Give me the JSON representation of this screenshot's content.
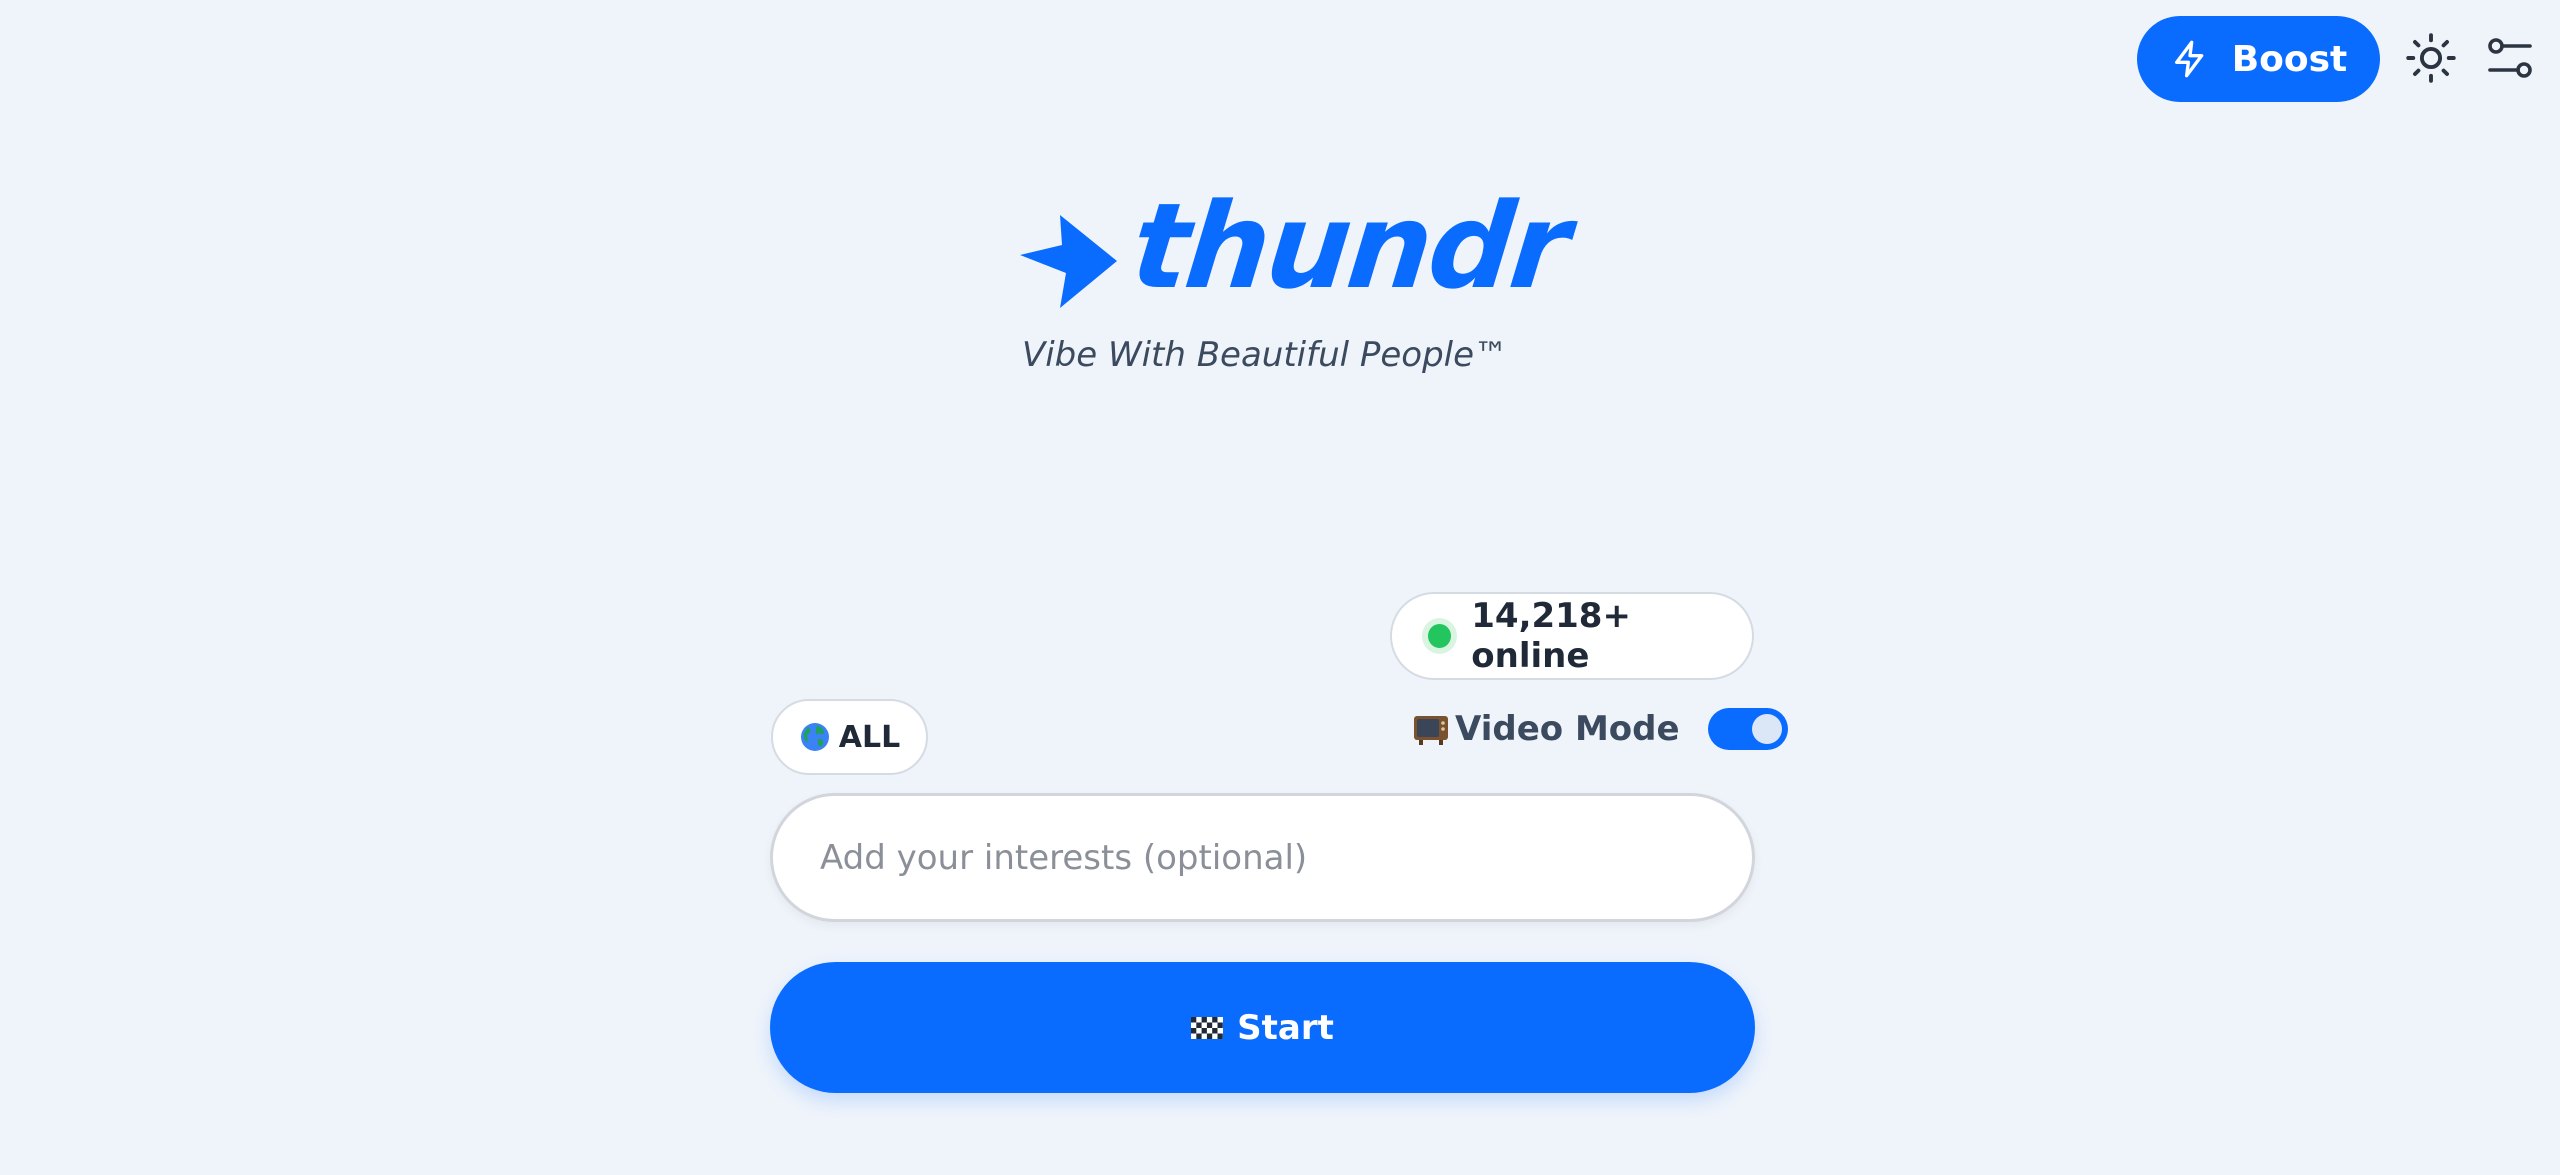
{
  "header": {
    "boost_label": "Boost",
    "icons": [
      "bolt-icon",
      "sun-icon",
      "sliders-icon"
    ]
  },
  "brand": {
    "name": "thundr",
    "tagline": "Vibe With Beautiful People™"
  },
  "status": {
    "online_text": "14,218+ online"
  },
  "region": {
    "label": "ALL"
  },
  "video_mode": {
    "label": "Video Mode",
    "enabled": true
  },
  "interests": {
    "placeholder": "Add your interests (optional)",
    "value": ""
  },
  "start": {
    "label": "Start"
  },
  "colors": {
    "accent": "#0a6cff",
    "background": "#eff4fb",
    "online": "#22c55e"
  }
}
